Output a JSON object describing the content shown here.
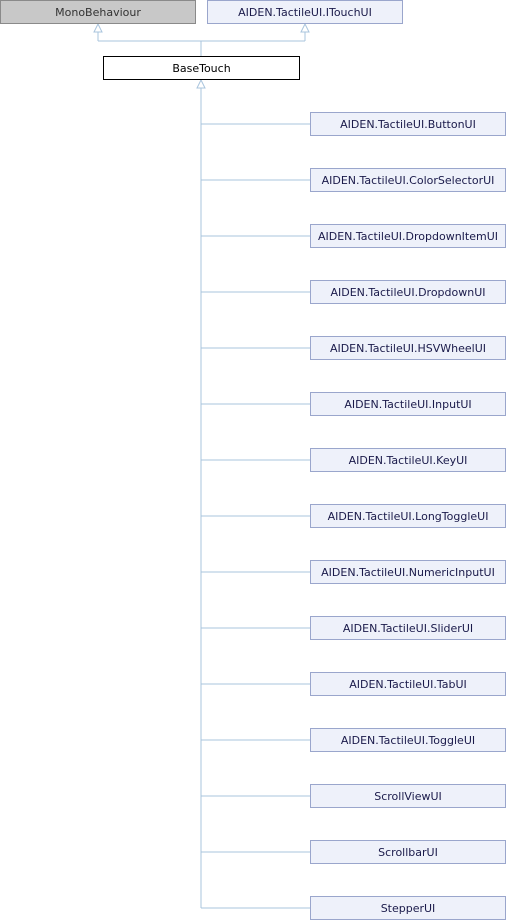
{
  "colors": {
    "edge": "#a9c4dd",
    "external_fill": "#c8c8c8",
    "node_fill": "#eef1fa",
    "node_border": "#9aa6cc",
    "base_border": "#000000"
  },
  "diagram": {
    "parents": [
      {
        "id": "monobehaviour",
        "label": "MonoBehaviour",
        "kind": "external"
      },
      {
        "id": "itouchui",
        "label": "AIDEN.TactileUI.ITouchUI",
        "kind": "interface"
      }
    ],
    "base": {
      "id": "basetouch",
      "label": "BaseTouch"
    },
    "children": [
      {
        "id": "buttonui",
        "label": "AIDEN.TactileUI.ButtonUI"
      },
      {
        "id": "colorselectorui",
        "label": "AIDEN.TactileUI.ColorSelectorUI"
      },
      {
        "id": "dropdownitemui",
        "label": "AIDEN.TactileUI.DropdownItemUI"
      },
      {
        "id": "dropdownui",
        "label": "AIDEN.TactileUI.DropdownUI"
      },
      {
        "id": "hsvwheelui",
        "label": "AIDEN.TactileUI.HSVWheelUI"
      },
      {
        "id": "inputui",
        "label": "AIDEN.TactileUI.InputUI"
      },
      {
        "id": "keyui",
        "label": "AIDEN.TactileUI.KeyUI"
      },
      {
        "id": "longtoggleui",
        "label": "AIDEN.TactileUI.LongToggleUI"
      },
      {
        "id": "numericinputui",
        "label": "AIDEN.TactileUI.NumericInputUI"
      },
      {
        "id": "sliderui",
        "label": "AIDEN.TactileUI.SliderUI"
      },
      {
        "id": "tabui",
        "label": "AIDEN.TactileUI.TabUI"
      },
      {
        "id": "toggleui",
        "label": "AIDEN.TactileUI.ToggleUI"
      },
      {
        "id": "scrollviewui",
        "label": "ScrollViewUI"
      },
      {
        "id": "scrollbarui",
        "label": "ScrollbarUI"
      },
      {
        "id": "stepperui",
        "label": "StepperUI"
      }
    ]
  }
}
